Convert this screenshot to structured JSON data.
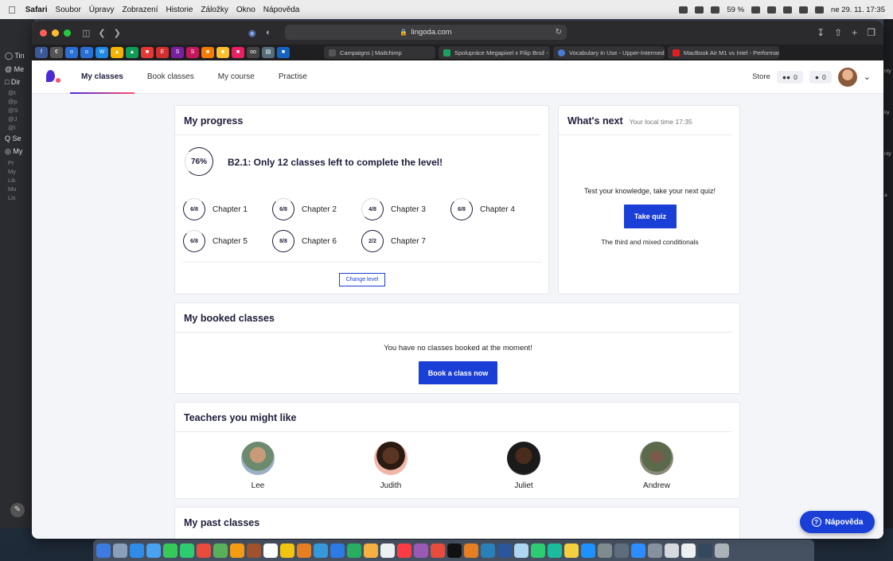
{
  "menubar": {
    "app": "Safari",
    "items": [
      "Soubor",
      "Úpravy",
      "Zobrazení",
      "Historie",
      "Záložky",
      "Okno",
      "Nápověda"
    ],
    "battery": "59 %",
    "datetime": "ne 29. 11.  17:35"
  },
  "browser": {
    "url": "lingoda.com",
    "tabs": [
      {
        "label": "Campaigns | Mailchimp",
        "color": "#555555"
      },
      {
        "label": "Spolupráce Megapixel x Filip Brož - Ta...",
        "color": "#1aa260"
      },
      {
        "label": "Vocabulary in Use - Upper-Intermediat...",
        "color": "#4a7bd6"
      },
      {
        "label": "MacBook Air M1 vs Intel - Performanc...",
        "color": "#e02020"
      }
    ]
  },
  "nav": {
    "links": [
      "My classes",
      "Book classes",
      "My course",
      "Practise"
    ],
    "store": "Store",
    "group_count": "0",
    "private_count": "0"
  },
  "progress": {
    "title": "My progress",
    "percent": "76%",
    "percent_value": 76,
    "headline": "B2.1: Only 12 classes left to complete the level!",
    "chapters": [
      {
        "count": "6/8",
        "label": "Chapter 1"
      },
      {
        "count": "6/8",
        "label": "Chapter 2"
      },
      {
        "count": "4/8",
        "label": "Chapter 3"
      },
      {
        "count": "6/8",
        "label": "Chapter 4"
      },
      {
        "count": "6/8",
        "label": "Chapter 5"
      },
      {
        "count": "8/8",
        "label": "Chapter 6"
      },
      {
        "count": "2/2",
        "label": "Chapter 7"
      }
    ],
    "change_level": "Change level"
  },
  "whats_next": {
    "title": "What's next",
    "local_time": "Your local time 17:35",
    "prompt": "Test your knowledge, take your next quiz!",
    "button": "Take quiz",
    "topic": "The third and mixed conditionals"
  },
  "booked": {
    "title": "My booked classes",
    "empty": "You have no classes booked at the moment!",
    "button": "Book a class now"
  },
  "teachers": {
    "title": "Teachers you might like",
    "list": [
      "Lee",
      "Judith",
      "Juliet",
      "Andrew"
    ]
  },
  "past": {
    "title": "My past classes"
  },
  "help": {
    "label": "Nápověda"
  },
  "colors": {
    "brand": "#4b2bd6",
    "accent": "#ff4f6d",
    "button": "#1a3fd6"
  }
}
